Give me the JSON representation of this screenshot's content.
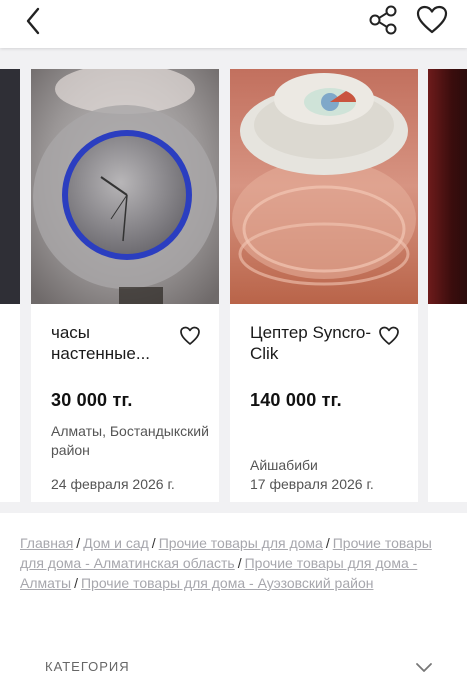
{
  "header": {
    "back_icon": "chevron-left-icon",
    "share_icon": "share-icon",
    "favorite_icon": "heart-outline-icon"
  },
  "similar_items": [
    {
      "title": "часы настенные...",
      "price": "30 000 тг.",
      "location": "Алматы, Бостандыкский район",
      "date": "24 февраля 2026 г.",
      "image": "wall-clock-photo"
    },
    {
      "title": "Цептер Syncro-Clik",
      "price": "140 000 тг.",
      "location": "Айшабиби",
      "date": "17 февраля 2026 г.",
      "image": "cookware-lid-photo"
    }
  ],
  "breadcrumbs": [
    "Главная",
    "Дом и сад",
    "Прочие товары для дома",
    "Прочие товары для дома - Алматинская область",
    "Прочие товары для дома - Алматы",
    "Прочие товары для дома - Ауэзовский район"
  ],
  "breadcrumb_separator": "/",
  "category": {
    "label": "КАТЕГОРИЯ",
    "icon": "chevron-down-icon"
  },
  "colors": {
    "background_strip": "#f1f1f3",
    "text_primary": "#111111",
    "text_secondary": "#555555",
    "link_muted": "#a7a7ad"
  }
}
